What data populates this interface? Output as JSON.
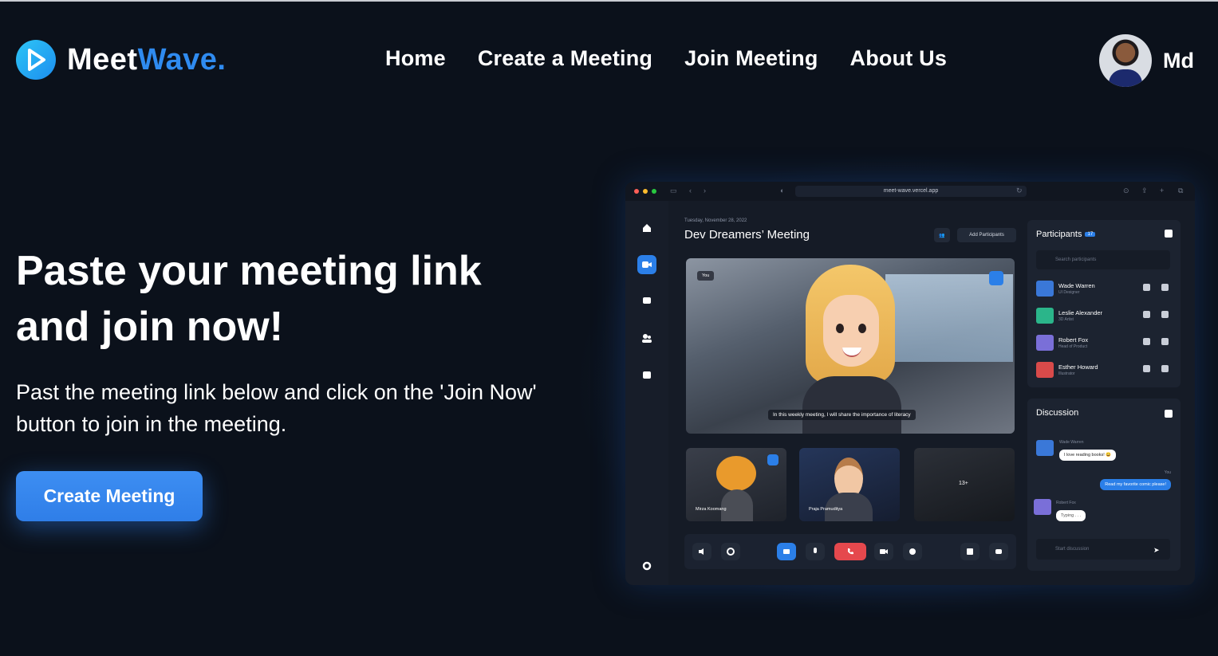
{
  "brand": {
    "name_part1": "Meet",
    "name_part2": "Wave.",
    "accent": "#2f8bf0"
  },
  "nav": {
    "items": [
      "Home",
      "Create a Meeting",
      "Join Meeting",
      "About Us"
    ]
  },
  "user": {
    "name": "Md"
  },
  "hero": {
    "title": "Paste your meeting link and join now!",
    "subtitle": "Past the meeting link below and click on the 'Join Now' button to join in the meeting.",
    "cta_label": "Create Meeting"
  },
  "mockup": {
    "url": "meet-wave.vercel.app",
    "date": "Tuesday, November 28, 2022",
    "title": "Dev Dreamers’ Meeting",
    "add_participants": "Add Participants",
    "you_tag": "You",
    "caption": "In this weekly meeting, I will share the importance of literacy",
    "thumbs": [
      "Mirza Koomang",
      "Praja Pramuditya",
      "13+"
    ],
    "participants": {
      "title": "Participants",
      "count": "17",
      "search_placeholder": "Search participants",
      "people": [
        {
          "name": "Wade Warren",
          "role": "UI Designer"
        },
        {
          "name": "Leslie Alexander",
          "role": "3D Artist"
        },
        {
          "name": "Robert Fox",
          "role": "Head of Product"
        },
        {
          "name": "Esther Howard",
          "role": "Illustrator"
        }
      ]
    },
    "discussion": {
      "title": "Discussion",
      "msg1_author": "Wade Warren",
      "msg1_text": "I love reading books! 😄",
      "msg2_author": "You",
      "msg2_text": "Read my favorite comic please!",
      "msg3_author": "Robert Fox",
      "msg3_text": "Typing . . .",
      "input_placeholder": "Start discussion"
    }
  },
  "colors": {
    "background": "#0b111b",
    "primary": "#2f7ee8",
    "danger": "#e5484d"
  }
}
